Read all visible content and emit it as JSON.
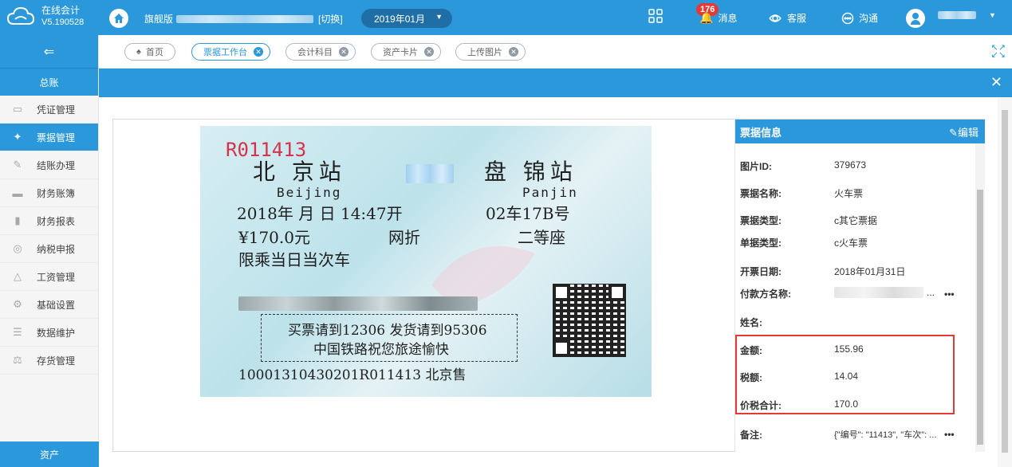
{
  "app": {
    "name": "在线会计",
    "version": "V5.190528"
  },
  "header": {
    "edition": "旗舰版",
    "switch_label": "[切换]",
    "period": "2019年01月",
    "message_badge": "176",
    "message_label": "消息",
    "service_label": "客服",
    "chat_label": "沟通"
  },
  "sidebar": {
    "section": "总账",
    "items": [
      {
        "label": "凭证管理",
        "icon": "wallet-icon"
      },
      {
        "label": "票据管理",
        "icon": "ticket-icon"
      },
      {
        "label": "结账办理",
        "icon": "pen-icon"
      },
      {
        "label": "财务账簿",
        "icon": "book-icon"
      },
      {
        "label": "财务报表",
        "icon": "bar-chart-icon"
      },
      {
        "label": "纳税申报",
        "icon": "circle-icon"
      },
      {
        "label": "工资管理",
        "icon": "flask-icon"
      },
      {
        "label": "基础设置",
        "icon": "gear-icon"
      },
      {
        "label": "数据维护",
        "icon": "database-icon"
      },
      {
        "label": "存货管理",
        "icon": "scale-icon"
      }
    ],
    "bottom": "资产"
  },
  "tabs": [
    {
      "label": "首页"
    },
    {
      "label": "票据工作台"
    },
    {
      "label": "会计科目"
    },
    {
      "label": "资产卡片"
    },
    {
      "label": "上传图片"
    }
  ],
  "ticket": {
    "serial": "R011413",
    "from_cn": "北 京站",
    "to_cn": "盘 锦站",
    "from_en": "Beijing",
    "to_en": "Panjin",
    "date_time": "2018年 月 日 14:47开",
    "seat": "02车17B号",
    "price": "¥170.0元",
    "channel": "网折",
    "class": "二等座",
    "notice": "限乘当日当次车",
    "box_line1": "买票请到12306 发货请到95306",
    "box_line2": "中国铁路祝您旅途愉快",
    "footer": "10001310430201R011413 北京售"
  },
  "panel": {
    "title": "票据信息",
    "edit_label": "编辑",
    "fields": [
      {
        "key": "图片ID:",
        "value": "379673"
      },
      {
        "key": "票据名称:",
        "value": "火车票"
      },
      {
        "key": "票据类型:",
        "value": "c其它票据"
      },
      {
        "key": "单据类型:",
        "value": "c火车票"
      },
      {
        "key": "开票日期:",
        "value": "2018年01月31日"
      },
      {
        "key": "付款方名称:",
        "value": "..."
      },
      {
        "key": "姓名:",
        "value": ""
      },
      {
        "key": "金额:",
        "value": "155.96"
      },
      {
        "key": "税额:",
        "value": "14.04"
      },
      {
        "key": "价税合计:",
        "value": "170.0"
      },
      {
        "key": "备注:",
        "value": "{\"编号\": \"11413\", \"车次\": ..."
      }
    ],
    "more": "•••"
  },
  "colors": {
    "primary": "#2b98dc",
    "highlight": "#e53935"
  }
}
